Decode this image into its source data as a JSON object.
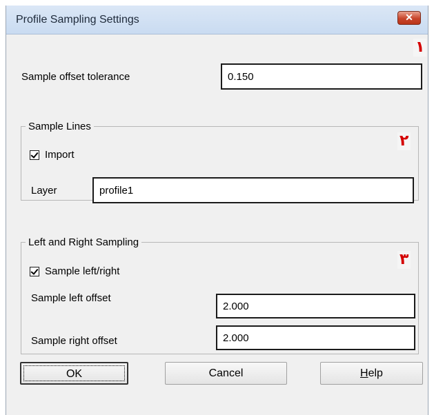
{
  "window": {
    "title": "Profile Sampling Settings",
    "close_glyph": "✕"
  },
  "markers": {
    "one": "١",
    "two": "٢",
    "three": "٣"
  },
  "tolerance": {
    "label": "Sample offset tolerance",
    "value": "0.150"
  },
  "sample_lines": {
    "legend": "Sample Lines",
    "import_label": "Import",
    "import_checked": true,
    "layer_label": "Layer",
    "layer_value": "profile1"
  },
  "left_right": {
    "legend": "Left and Right Sampling",
    "checkbox_label": "Sample left/right",
    "checked": true,
    "left_label": "Sample left offset",
    "left_value": "2.000",
    "right_label": "Sample right offset",
    "right_value": "2.000"
  },
  "buttons": {
    "ok": "OK",
    "cancel": "Cancel",
    "help_mnemonic": "H",
    "help_rest": "elp"
  },
  "colors": {
    "marker": "#d40000",
    "titlebar": "#c9dbf1",
    "close": "#c8452b"
  }
}
